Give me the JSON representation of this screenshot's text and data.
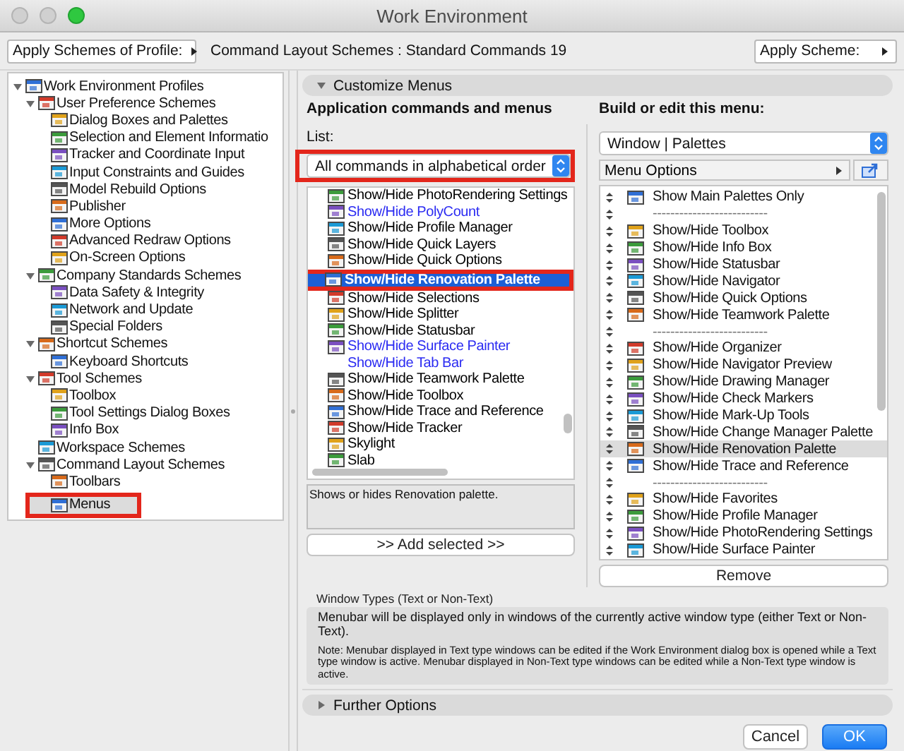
{
  "window": {
    "title": "Work Environment"
  },
  "toolbar": {
    "profile_button": "Apply Schemes of Profile:",
    "scheme_label": "Command Layout Schemes : Standard Commands 19",
    "apply_button": "Apply Scheme:"
  },
  "tree": [
    {
      "label": "Work Environment Profiles",
      "expanded": true,
      "selected": false,
      "highlighted": false,
      "children": [
        {
          "label": "User Preference Schemes",
          "expanded": true,
          "selected": false,
          "highlighted": false,
          "children": [
            {
              "label": "Dialog Boxes and Palettes",
              "selected": false,
              "highlighted": false
            },
            {
              "label": "Selection and Element Informatio",
              "selected": false,
              "highlighted": false
            },
            {
              "label": "Tracker and Coordinate Input",
              "selected": false,
              "highlighted": false
            },
            {
              "label": "Input Constraints and Guides",
              "selected": false,
              "highlighted": false
            },
            {
              "label": "Model Rebuild Options",
              "selected": false,
              "highlighted": false
            },
            {
              "label": "Publisher",
              "selected": false,
              "highlighted": false
            },
            {
              "label": "More Options",
              "selected": false,
              "highlighted": false
            },
            {
              "label": "Advanced Redraw Options",
              "selected": false,
              "highlighted": false
            },
            {
              "label": "On-Screen Options",
              "selected": false,
              "highlighted": false
            }
          ]
        },
        {
          "label": "Company Standards Schemes",
          "expanded": true,
          "selected": false,
          "highlighted": false,
          "children": [
            {
              "label": "Data Safety & Integrity",
              "selected": false,
              "highlighted": false
            },
            {
              "label": "Network and Update",
              "selected": false,
              "highlighted": false
            },
            {
              "label": "Special Folders",
              "selected": false,
              "highlighted": false
            }
          ]
        },
        {
          "label": "Shortcut Schemes",
          "expanded": true,
          "selected": false,
          "highlighted": false,
          "children": [
            {
              "label": "Keyboard Shortcuts",
              "selected": false,
              "highlighted": false
            }
          ]
        },
        {
          "label": "Tool Schemes",
          "expanded": true,
          "selected": false,
          "highlighted": false,
          "children": [
            {
              "label": "Toolbox",
              "selected": false,
              "highlighted": false
            },
            {
              "label": "Tool Settings Dialog Boxes",
              "selected": false,
              "highlighted": false
            },
            {
              "label": "Info Box",
              "selected": false,
              "highlighted": false
            }
          ]
        },
        {
          "label": "Workspace Schemes",
          "selected": false,
          "highlighted": false
        },
        {
          "label": "Command Layout Schemes",
          "expanded": true,
          "selected": false,
          "highlighted": false,
          "children": [
            {
              "label": "Toolbars",
              "selected": false,
              "highlighted": false
            },
            {
              "label": "Menus",
              "selected": true,
              "highlighted": true
            }
          ]
        }
      ]
    }
  ],
  "customize": {
    "title": "Customize Menus",
    "expanded": true,
    "commands": {
      "heading": "Application commands and menus",
      "list_label": "List:",
      "dropdown": {
        "value": "All commands in alphabetical order",
        "highlighted": true
      },
      "items": [
        {
          "label": "Show/Hide PhotoRendering Settings",
          "custom": false,
          "icon": true,
          "selected": false,
          "highlighted": false
        },
        {
          "label": "Show/Hide PolyCount",
          "custom": true,
          "icon": true,
          "selected": false,
          "highlighted": false
        },
        {
          "label": "Show/Hide Profile Manager",
          "custom": false,
          "icon": true,
          "selected": false,
          "highlighted": false
        },
        {
          "label": "Show/Hide Quick Layers",
          "custom": false,
          "icon": true,
          "selected": false,
          "highlighted": false
        },
        {
          "label": "Show/Hide Quick Options",
          "custom": false,
          "icon": true,
          "selected": false,
          "highlighted": false
        },
        {
          "label": "Show/Hide Renovation Palette",
          "custom": false,
          "icon": true,
          "selected": true,
          "highlighted": true
        },
        {
          "label": "Show/Hide Selections",
          "custom": false,
          "icon": true,
          "selected": false,
          "highlighted": false
        },
        {
          "label": "Show/Hide Splitter",
          "custom": false,
          "icon": true,
          "selected": false,
          "highlighted": false
        },
        {
          "label": "Show/Hide Statusbar",
          "custom": false,
          "icon": true,
          "selected": false,
          "highlighted": false
        },
        {
          "label": "Show/Hide Surface Painter",
          "custom": true,
          "icon": true,
          "selected": false,
          "highlighted": false
        },
        {
          "label": "Show/Hide Tab Bar",
          "custom": true,
          "icon": false,
          "selected": false,
          "highlighted": false
        },
        {
          "label": "Show/Hide Teamwork Palette",
          "custom": false,
          "icon": true,
          "selected": false,
          "highlighted": false
        },
        {
          "label": "Show/Hide Toolbox",
          "custom": false,
          "icon": true,
          "selected": false,
          "highlighted": false
        },
        {
          "label": "Show/Hide Trace and Reference",
          "custom": false,
          "icon": true,
          "selected": false,
          "highlighted": false
        },
        {
          "label": "Show/Hide Tracker",
          "custom": false,
          "icon": true,
          "selected": false,
          "highlighted": false
        },
        {
          "label": "Skylight",
          "custom": false,
          "icon": true,
          "selected": false,
          "highlighted": false
        },
        {
          "label": "Slab",
          "custom": false,
          "icon": true,
          "selected": false,
          "highlighted": false
        }
      ],
      "description": "Shows or hides Renovation palette.",
      "add_button": ">> Add selected >>"
    },
    "menu": {
      "heading": "Build or edit this menu:",
      "dropdown": "Window | Palettes",
      "options_button": "Menu Options",
      "items": [
        {
          "kind": "command",
          "label": "Show Main Palettes Only",
          "selected": false
        },
        {
          "kind": "separator",
          "label": "--------------------------",
          "selected": false
        },
        {
          "kind": "command",
          "label": "Show/Hide Toolbox",
          "selected": false
        },
        {
          "kind": "command",
          "label": "Show/Hide Info Box",
          "selected": false
        },
        {
          "kind": "command",
          "label": "Show/Hide Statusbar",
          "selected": false
        },
        {
          "kind": "command",
          "label": "Show/Hide Navigator",
          "selected": false
        },
        {
          "kind": "command",
          "label": "Show/Hide Quick Options",
          "selected": false
        },
        {
          "kind": "command",
          "label": "Show/Hide Teamwork Palette",
          "selected": false
        },
        {
          "kind": "separator",
          "label": "--------------------------",
          "selected": false
        },
        {
          "kind": "command",
          "label": "Show/Hide Organizer",
          "selected": false
        },
        {
          "kind": "command",
          "label": "Show/Hide Navigator Preview",
          "selected": false
        },
        {
          "kind": "command",
          "label": "Show/Hide Drawing Manager",
          "selected": false
        },
        {
          "kind": "command",
          "label": "Show/Hide Check Markers",
          "selected": false
        },
        {
          "kind": "command",
          "label": "Show/Hide Mark-Up Tools",
          "selected": false
        },
        {
          "kind": "command",
          "label": "Show/Hide Change Manager Palette",
          "selected": false
        },
        {
          "kind": "command",
          "label": "Show/Hide Renovation Palette",
          "selected": true
        },
        {
          "kind": "command",
          "label": "Show/Hide Trace and Reference",
          "selected": false
        },
        {
          "kind": "separator",
          "label": "--------------------------",
          "selected": false
        },
        {
          "kind": "command",
          "label": "Show/Hide Favorites",
          "selected": false
        },
        {
          "kind": "command",
          "label": "Show/Hide Profile Manager",
          "selected": false
        },
        {
          "kind": "command",
          "label": "Show/Hide PhotoRendering Settings",
          "selected": false
        },
        {
          "kind": "command",
          "label": "Show/Hide Surface Painter",
          "selected": false
        }
      ],
      "remove_button": "Remove"
    },
    "window_types": {
      "title": "Window Types (Text or Non-Text)",
      "text": "Menubar will be displayed only in windows of the currently active window type (either Text or Non-Text).",
      "note": "Note: Menubar displayed in Text type windows can be edited if the Work Environment dialog box is opened while a Text type window is active. Menubar displayed in Non-Text type windows can be edited while a Non-Text type window is active."
    }
  },
  "further_options": {
    "title": "Further Options",
    "expanded": false
  },
  "buttons": [
    {
      "label": "Cancel",
      "default": false
    },
    {
      "label": "OK",
      "default": true
    }
  ]
}
